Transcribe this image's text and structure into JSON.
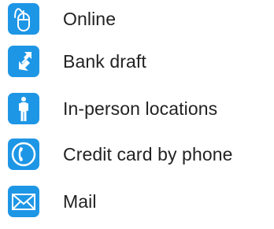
{
  "payment_options": {
    "accent_color": "#1e96e6",
    "items": [
      {
        "label": "Online",
        "icon": "computer-mouse-icon"
      },
      {
        "label": "Bank draft",
        "icon": "transfer-arrows-icon"
      },
      {
        "label": "In-person locations",
        "icon": "person-icon"
      },
      {
        "label": "Credit card by phone",
        "icon": "phone-icon"
      },
      {
        "label": "Mail",
        "icon": "envelope-icon"
      }
    ]
  }
}
